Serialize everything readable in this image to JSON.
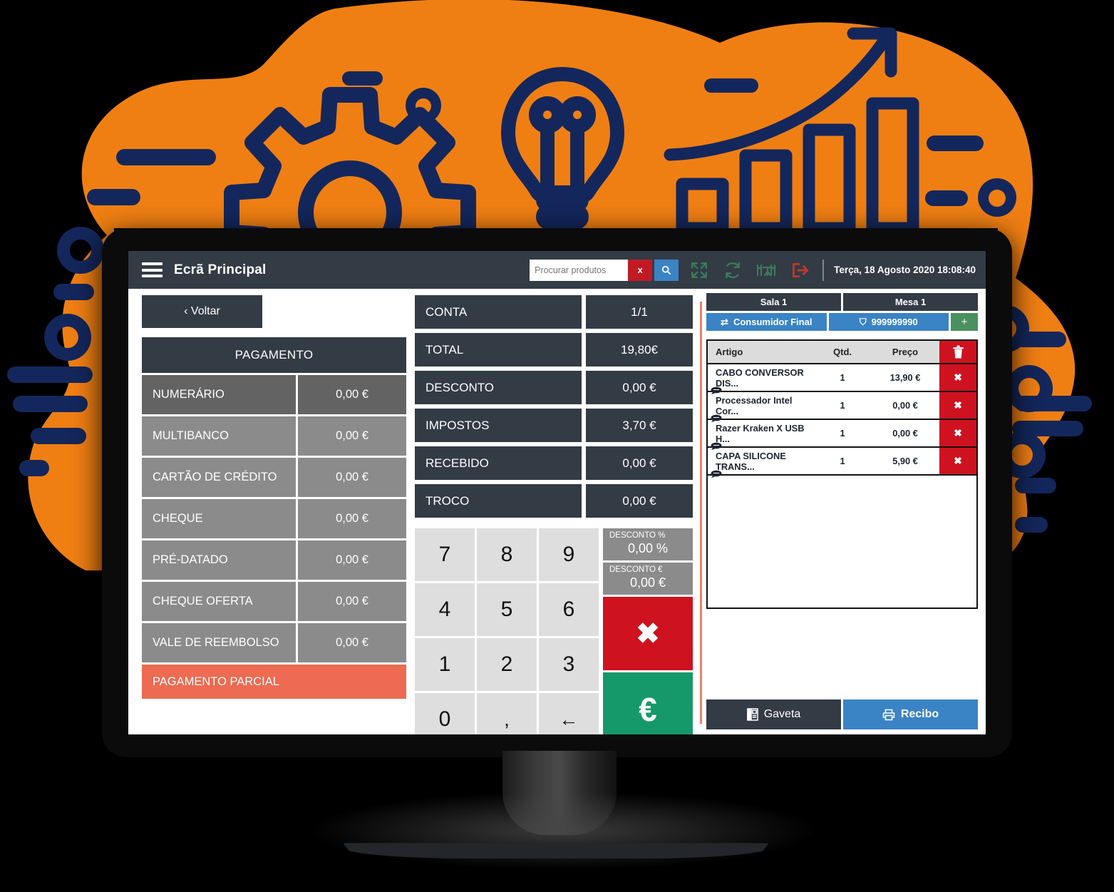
{
  "theme": {
    "orange": "#F07F13",
    "navy": "#14275C",
    "dark": "#333b45",
    "blue": "#3a83c4",
    "red": "#ce1220",
    "green": "#15996a",
    "coral": "#ec6b52",
    "gray": "#8b8b8b"
  },
  "topbar": {
    "menu_icon": "hamburger-icon",
    "title": "Ecrã Principal",
    "search": {
      "placeholder": "Procurar produtos",
      "value": "",
      "clear_label": "x",
      "search_label": "Q"
    },
    "icons": [
      {
        "name": "fullscreen-icon",
        "color": "#3b7a5a"
      },
      {
        "name": "refresh-icon",
        "color": "#3b7a5a"
      },
      {
        "name": "tables-icon",
        "color": "#3b7a5a"
      },
      {
        "name": "logout-icon",
        "color": "#c0392b"
      }
    ],
    "clock": "Terça, 18 Agosto 2020 18:08:40"
  },
  "left_panel": {
    "back_label": "‹ Voltar",
    "header": "PAGAMENTO",
    "methods": [
      {
        "label": "NUMERÁRIO",
        "value": "0,00 €",
        "highlight": true
      },
      {
        "label": "MULTIBANCO",
        "value": "0,00 €",
        "highlight": false
      },
      {
        "label": "CARTÃO DE CRÉDITO",
        "value": "0,00 €",
        "highlight": false
      },
      {
        "label": "CHEQUE",
        "value": "0,00 €",
        "highlight": false
      },
      {
        "label": "PRÉ-DATADO",
        "value": "0,00 €",
        "highlight": false
      },
      {
        "label": "CHEQUE OFERTA",
        "value": "0,00 €",
        "highlight": false
      },
      {
        "label": "VALE DE REEMBOLSO",
        "value": "0,00 €",
        "highlight": false
      }
    ],
    "partial_payment": "PAGAMENTO PARCIAL"
  },
  "totals": [
    {
      "label": "CONTA",
      "value": "1/1"
    },
    {
      "label": "TOTAL",
      "value": "19,80€"
    },
    {
      "label": "DESCONTO",
      "value": "0,00 €"
    },
    {
      "label": "IMPOSTOS",
      "value": "3,70 €"
    },
    {
      "label": "RECEBIDO",
      "value": "0,00 €"
    },
    {
      "label": "TROCO",
      "value": "0,00 €"
    }
  ],
  "keypad": {
    "keys": [
      "7",
      "8",
      "9",
      "4",
      "5",
      "6",
      "1",
      "2",
      "3",
      "0",
      ",",
      "←"
    ],
    "discount_percent": {
      "label": "DESCONTO %",
      "value": "0,00 %"
    },
    "discount_euro": {
      "label": "DESCONTO €",
      "value": "0,00 €"
    },
    "cancel_glyph": "✖",
    "confirm_glyph": "€"
  },
  "right_panel": {
    "room": "Sala 1",
    "table": "Mesa 1",
    "customer": "Consumidor Final",
    "tax_id": "999999990",
    "add_label": "+",
    "cart_headers": {
      "article": "Artigo",
      "qty": "Qtd.",
      "price": "Preço"
    },
    "cart_items": [
      {
        "article": "CABO CONVERSOR DIS...",
        "qty": "1",
        "price": "13,90 €",
        "remove": "✖"
      },
      {
        "article": "Processador Intel Cor...",
        "qty": "1",
        "price": "0,00 €",
        "remove": "✖"
      },
      {
        "article": "Razer Kraken X USB H...",
        "qty": "1",
        "price": "0,00 €",
        "remove": "✖"
      },
      {
        "article": "CAPA SILICONE TRANS...",
        "qty": "1",
        "price": "5,90 €",
        "remove": "✖"
      }
    ],
    "drawer_label": "Gaveta",
    "receipt_label": "Recibo"
  }
}
